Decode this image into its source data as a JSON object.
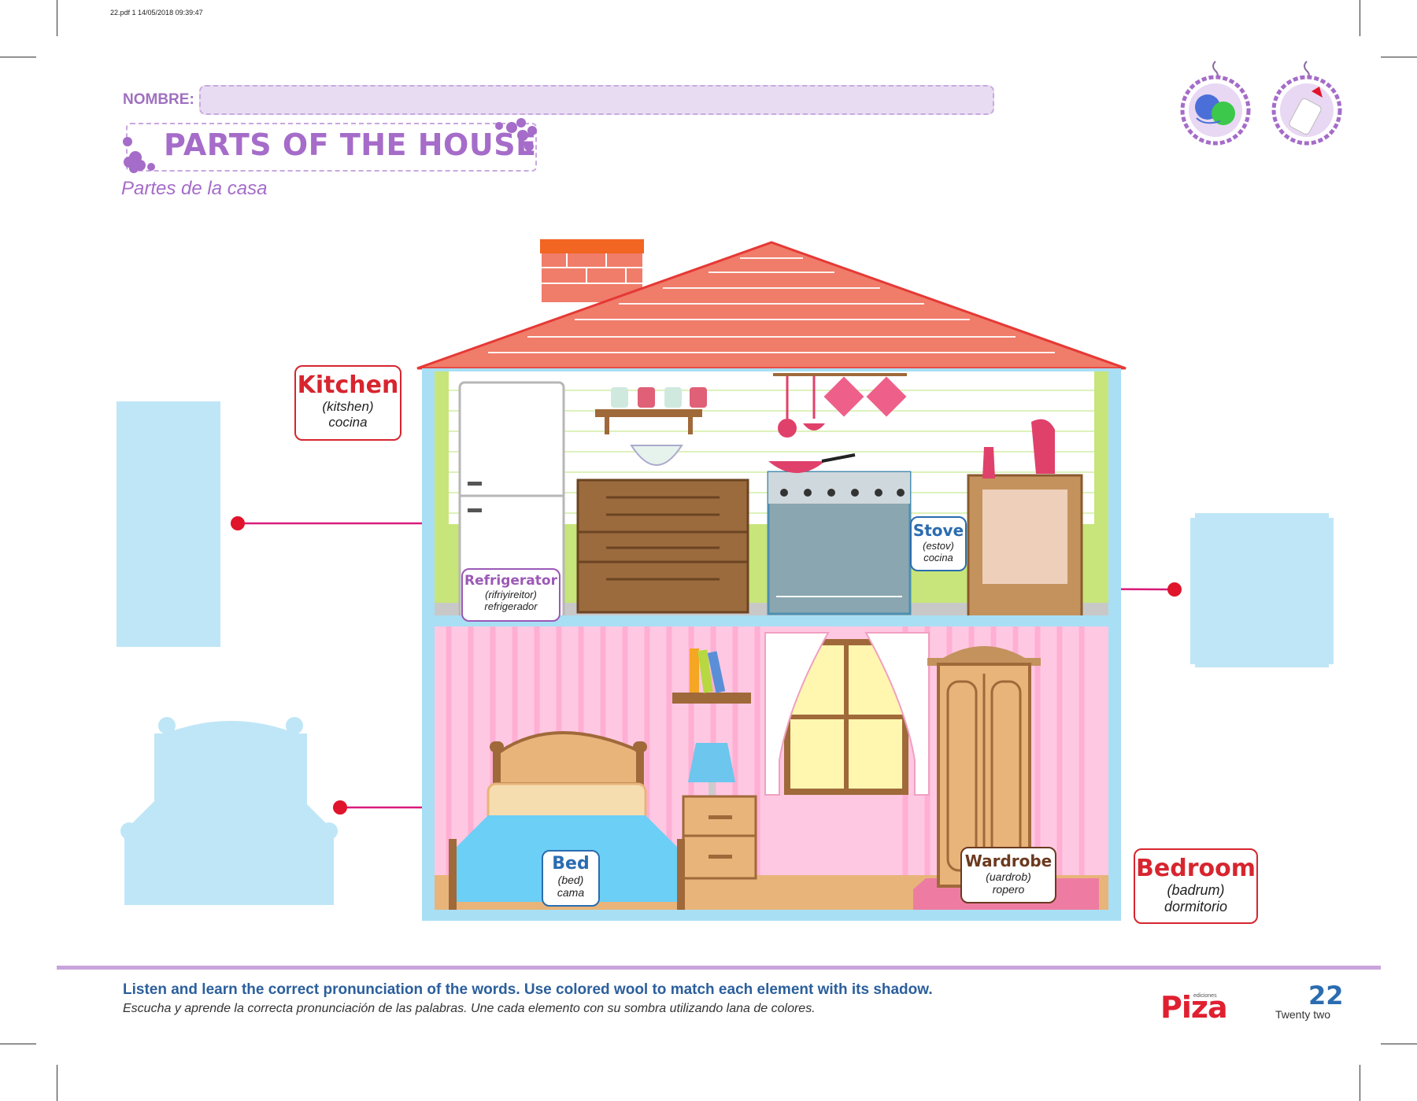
{
  "header": {
    "pdf_info": "22.pdf   1   14/05/2018   09:39:47",
    "name_label": "NOMBRE:",
    "title": "PARTS OF THE HOUSE",
    "subtitle": "Partes de la casa"
  },
  "icons": [
    "wool-icon",
    "glue-icon"
  ],
  "labels": {
    "kitchen": {
      "word": "Kitchen",
      "pron": "(kitshen)",
      "spanish": "cocina",
      "color": "#d7252f"
    },
    "refrigerator": {
      "word": "Refrigerator",
      "pron": "(rifriyireitor)",
      "spanish": "refrigerador",
      "color": "#9b59b6"
    },
    "stove": {
      "word": "Stove",
      "pron": "(estov)",
      "spanish": "cocina",
      "color": "#2b6cb0"
    },
    "bed": {
      "word": "Bed",
      "pron": "(bed)",
      "spanish": "cama",
      "color": "#2b6cb0"
    },
    "wardrobe": {
      "word": "Wardrobe",
      "pron": "(uardrob)",
      "spanish": "ropero",
      "color": "#6b3a1f"
    },
    "bedroom": {
      "word": "Bedroom",
      "pron": "(badrum)",
      "spanish": "dormitorio",
      "color": "#d7252f"
    }
  },
  "shadows": [
    "refrigerator-shadow",
    "stove-shadow",
    "bed-shadow"
  ],
  "footer": {
    "instruction_en": "Listen and learn the correct pronunciation of the words. Use colored wool to match each element with its shadow.",
    "instruction_es": "Escucha y aprende la correcta pronunciación de las palabras. Une cada elemento con su sombra utilizando lana de colores.",
    "publisher_small": "ediciones",
    "publisher": "Piza",
    "page_number": "22",
    "page_words": "Twenty two"
  },
  "colors": {
    "accent_purple": "#a56cc9",
    "shadow_blue": "#bfe6f7",
    "roof_red": "#f07c6a",
    "line_magenta": "#d81b7a",
    "dot_red": "#e0142a"
  }
}
